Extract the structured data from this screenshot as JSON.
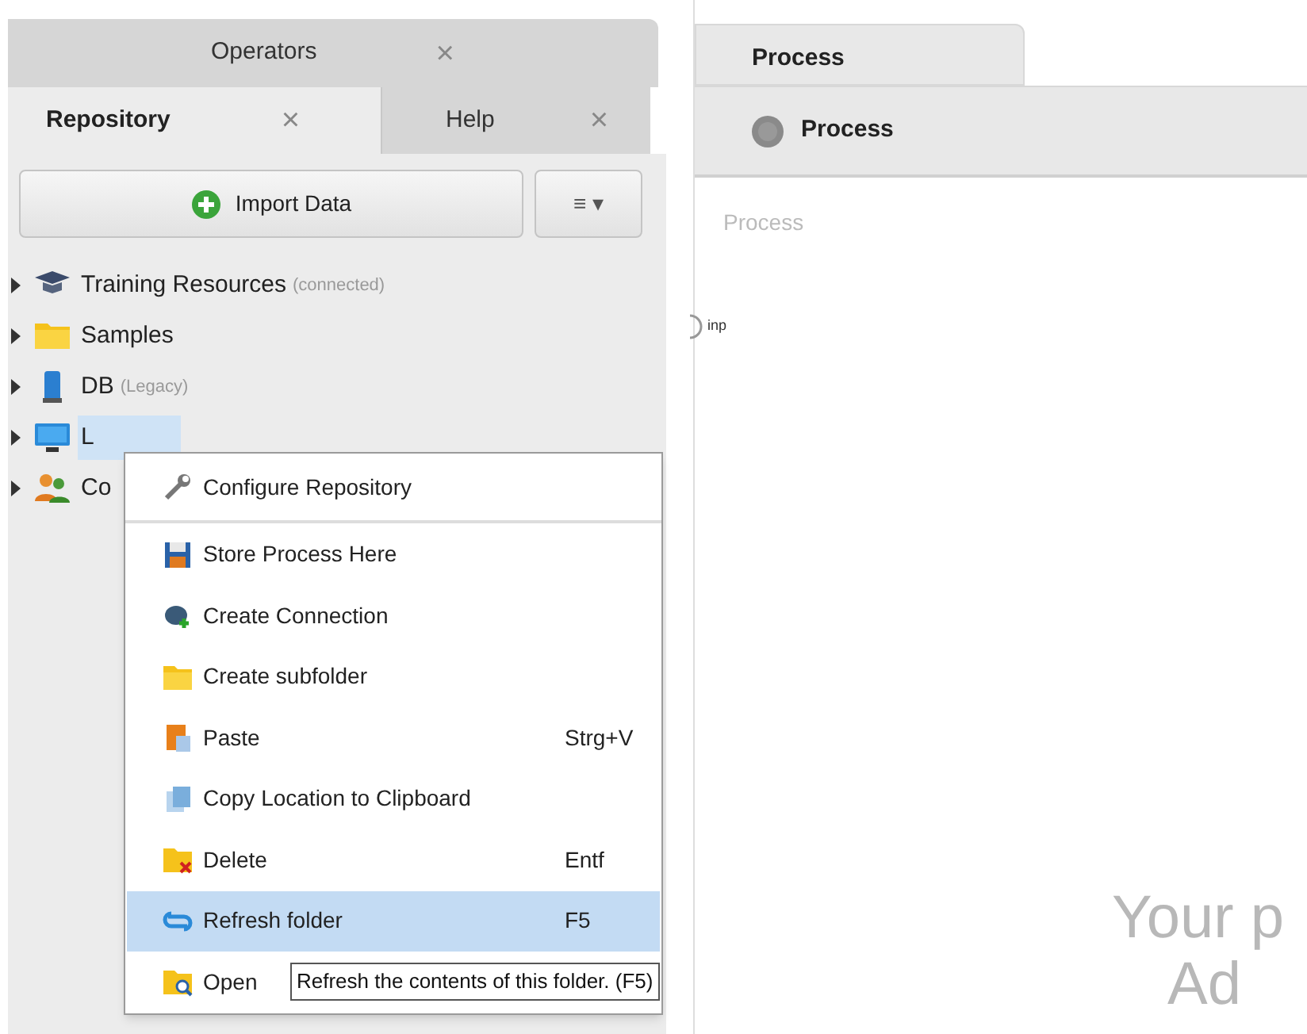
{
  "left_panel": {
    "tabs_top": [
      {
        "label": "Operators",
        "close": "×",
        "selected": false
      }
    ],
    "tabs": [
      {
        "label": "Repository",
        "close": "×",
        "selected": true
      },
      {
        "label": "Help",
        "close": "×",
        "selected": false
      }
    ],
    "import_button": {
      "label": "Import Data"
    },
    "menu_button": {
      "label": "≡ ▾"
    },
    "tree": [
      {
        "label": "Training Resources",
        "note": "(connected)",
        "selected": false
      },
      {
        "label": "Samples",
        "selected": false
      },
      {
        "label": "DB",
        "note": "(Legacy)",
        "selected": false
      },
      {
        "label": "L",
        "selected": true
      },
      {
        "label": "Co",
        "selected": false
      }
    ]
  },
  "context_menu": {
    "items": [
      {
        "label": "Configure Repository",
        "separator_after": true,
        "selected": false
      },
      {
        "label": "Store Process Here",
        "selected": false
      },
      {
        "label": "Create Connection",
        "selected": false
      },
      {
        "label": "Create subfolder",
        "selected": false
      },
      {
        "label": "Paste",
        "shortcut": "Strg+V",
        "selected": false
      },
      {
        "label": "Copy Location to Clipboard",
        "selected": false
      },
      {
        "label": "Delete",
        "shortcut": "Entf",
        "selected": false
      },
      {
        "label": "Refresh folder",
        "shortcut": "F5",
        "selected": true
      },
      {
        "label": "Open",
        "selected": false
      }
    ]
  },
  "tooltip": "Refresh the contents of this folder. (F5)",
  "process_panel": {
    "tab": {
      "label": "Process",
      "selected": true
    },
    "breadcrumb": "Process",
    "canvas_title": "Process",
    "port": "inp",
    "hint_lines": [
      "Your p",
      "Ad"
    ]
  }
}
